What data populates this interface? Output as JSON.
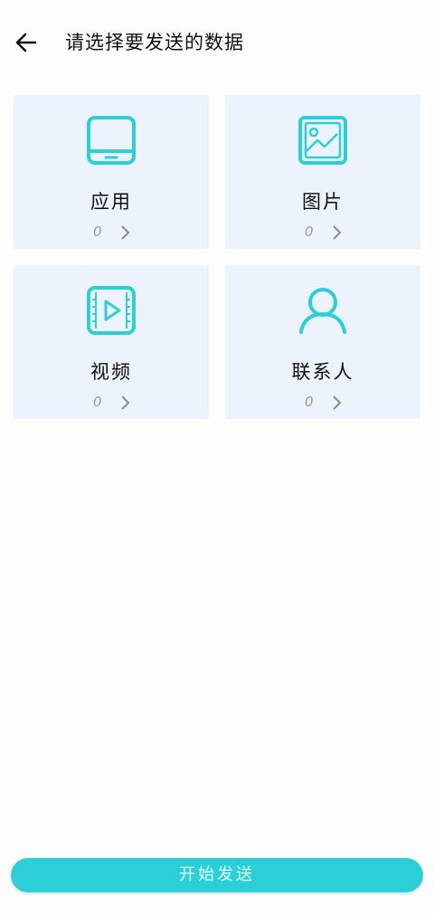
{
  "header": {
    "title": "请选择要发送的数据",
    "back_icon": "arrow-left-icon"
  },
  "colors": {
    "accent": "#2bcfd8",
    "card_bg": "#edf3fd"
  },
  "categories": [
    {
      "label": "应用",
      "count": "0",
      "icon": "tablet-icon"
    },
    {
      "label": "图片",
      "count": "0",
      "icon": "image-icon"
    },
    {
      "label": "视频",
      "count": "0",
      "icon": "video-icon"
    },
    {
      "label": "联系人",
      "count": "0",
      "icon": "person-icon"
    }
  ],
  "footer": {
    "start_label": "开始发送"
  }
}
